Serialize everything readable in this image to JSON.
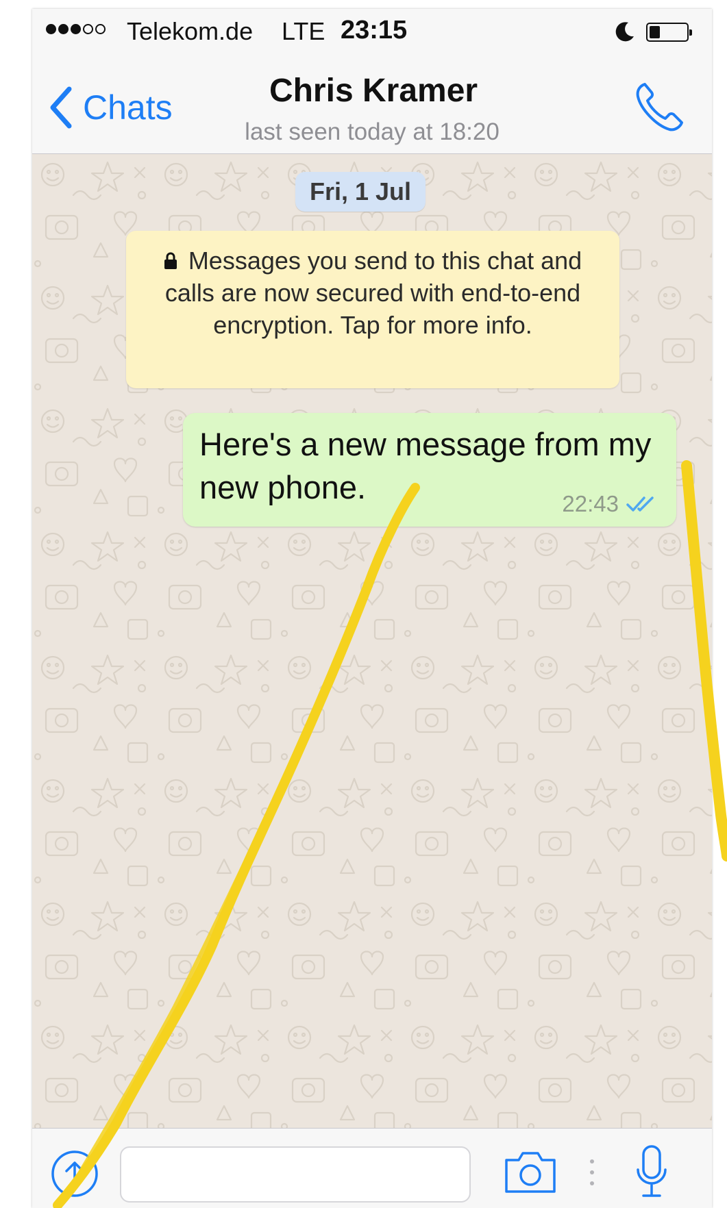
{
  "status_bar": {
    "signal_bars_filled": 3,
    "signal_bars_total": 5,
    "carrier": "Telekom.de",
    "network": "LTE",
    "time": "23:15",
    "dnd_icon": "moon-icon",
    "battery_level": 0.2
  },
  "nav": {
    "back_label": "Chats",
    "contact_name": "Chris Kramer",
    "contact_status": "last seen today at 18:20",
    "call_icon": "phone-icon"
  },
  "chat": {
    "date_label": "Fri, 1 Jul",
    "encryption_notice": "Messages you send to this chat and calls are now secured with end-to-end encryption. Tap for more info.",
    "messages": [
      {
        "direction": "outgoing",
        "text": "Here's a new message from my new phone.",
        "time": "22:43",
        "status": "read"
      }
    ]
  },
  "input_bar": {
    "message_placeholder": "",
    "share_icon": "share-arrow-icon",
    "camera_icon": "camera-icon",
    "mic_icon": "microphone-icon"
  },
  "colors": {
    "accent": "#1e7ef5",
    "chat_background": "#ece5dd",
    "outgoing_bubble": "#dcf8c6",
    "notice_background": "#fdf3c4",
    "date_chip": "#d4e3f6",
    "annotation_stroke": "#f5d21e"
  }
}
